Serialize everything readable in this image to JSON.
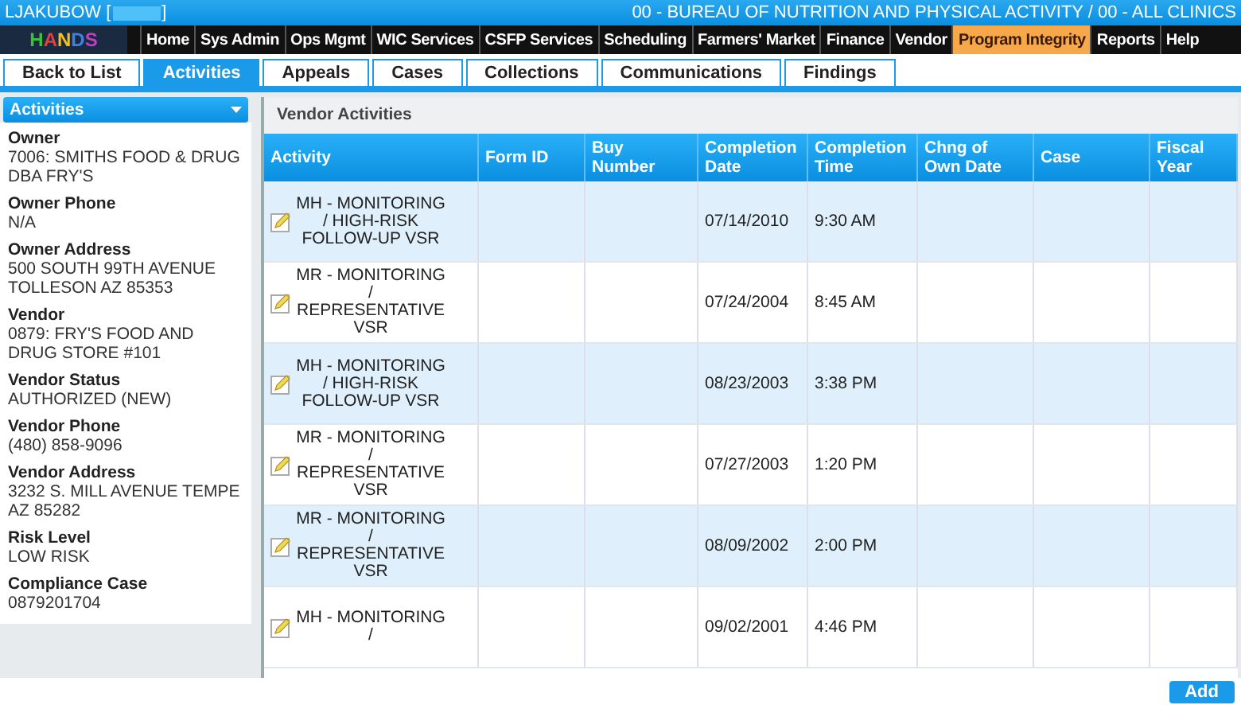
{
  "header": {
    "user": "LJAKUBOW [",
    "user_suffix": "]",
    "context": "00 - BUREAU OF NUTRITION AND PHYSICAL ACTIVITY / 00 - ALL CLINICS"
  },
  "logo": "HANDS",
  "nav": [
    {
      "label": "Home",
      "selected": false
    },
    {
      "label": "Sys Admin",
      "selected": false
    },
    {
      "label": "Ops Mgmt",
      "selected": false
    },
    {
      "label": "WIC Services",
      "selected": false
    },
    {
      "label": "CSFP Services",
      "selected": false
    },
    {
      "label": "Scheduling",
      "selected": false
    },
    {
      "label": "Farmers' Market",
      "selected": false
    },
    {
      "label": "Finance",
      "selected": false
    },
    {
      "label": "Vendor",
      "selected": false
    },
    {
      "label": "Program Integrity",
      "selected": true
    },
    {
      "label": "Reports",
      "selected": false
    },
    {
      "label": "Help",
      "selected": false
    }
  ],
  "tabs": [
    {
      "label": "Back to List",
      "selected": false
    },
    {
      "label": "Activities",
      "selected": true
    },
    {
      "label": "Appeals",
      "selected": false
    },
    {
      "label": "Cases",
      "selected": false
    },
    {
      "label": "Collections",
      "selected": false
    },
    {
      "label": "Communications",
      "selected": false
    },
    {
      "label": "Findings",
      "selected": false
    }
  ],
  "sidebar": {
    "title": "Activities",
    "fields": [
      {
        "label": "Owner",
        "value": "7006: SMITHS FOOD & DRUG DBA FRY'S"
      },
      {
        "label": "Owner Phone",
        "value": "N/A"
      },
      {
        "label": "Owner Address",
        "value": "500 SOUTH 99TH AVENUE TOLLESON AZ 85353"
      },
      {
        "label": "Vendor",
        "value": "0879: FRY'S FOOD AND DRUG STORE #101"
      },
      {
        "label": "Vendor Status",
        "value": "AUTHORIZED (NEW)"
      },
      {
        "label": "Vendor Phone",
        "value": "(480) 858-9096"
      },
      {
        "label": "Vendor Address",
        "value": "3232 S. MILL AVENUE TEMPE AZ 85282"
      },
      {
        "label": "Risk Level",
        "value": "LOW RISK"
      },
      {
        "label": "Compliance Case",
        "value": "0879201704"
      }
    ]
  },
  "table": {
    "title": "Vendor Activities",
    "columns": [
      "Activity",
      "Form ID",
      "Buy Number",
      "Completion Date",
      "Completion Time",
      "Chng of Own Date",
      "Case",
      "Fiscal Year"
    ],
    "rows": [
      {
        "activity": "MH - MONITORING / HIGH-RISK FOLLOW-UP VSR",
        "date": "07/14/2010",
        "time": "9:30 AM"
      },
      {
        "activity": "MR - MONITORING / REPRESENTATIVE VSR",
        "date": "07/24/2004",
        "time": "8:45 AM"
      },
      {
        "activity": "MH - MONITORING / HIGH-RISK FOLLOW-UP VSR",
        "date": "08/23/2003",
        "time": "3:38 PM"
      },
      {
        "activity": "MR - MONITORING / REPRESENTATIVE VSR",
        "date": "07/27/2003",
        "time": "1:20 PM"
      },
      {
        "activity": "MR - MONITORING / REPRESENTATIVE VSR",
        "date": "08/09/2002",
        "time": "2:00 PM"
      },
      {
        "activity": "MH - MONITORING /",
        "date": "09/02/2001",
        "time": "4:46 PM"
      }
    ]
  },
  "add_button": "Add"
}
